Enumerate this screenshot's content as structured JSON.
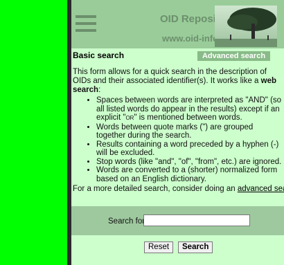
{
  "header": {
    "title": "OID Repository",
    "subtitle": "www.oid-info.com",
    "logo_icon": "tree-landscape-photo"
  },
  "search_section": {
    "title": "Basic search",
    "advanced_button": "Advanced search"
  },
  "intro": {
    "text": "This form allows for a quick search in the description of OIDs and their associated identifier(s). It works like a ",
    "emphasis": "web search",
    "end": ":"
  },
  "rules": {
    "r1_a": "Spaces between words are interpreted as \"AND\" (so all listed words do appear in the results) except if an explicit \"",
    "r1_or": "OR",
    "r1_b": "\" is mentioned between words.",
    "r2": "Words between quote marks (\") are grouped together during the search.",
    "r3": "Results containing a word preceded by a hyphen (-) will be excluded.",
    "r4": "Stop words (like \"and\", \"of\", \"from\", etc.) are ignored.",
    "r5": "Words are converted to a (shorter) normalized form based on an English dictionary."
  },
  "more": {
    "text": "For a more detailed search, consider doing an ",
    "link": "advanced search",
    "end": "."
  },
  "form": {
    "search_label": "Search for",
    "search_value": "",
    "reset_label": "Reset",
    "search_label_button": "Search"
  },
  "colors": {
    "left_bar": "#00ff00",
    "header_bg": "#99cc99",
    "panel_bg": "#ccffcc",
    "accent_text": "#6d8f6d"
  }
}
